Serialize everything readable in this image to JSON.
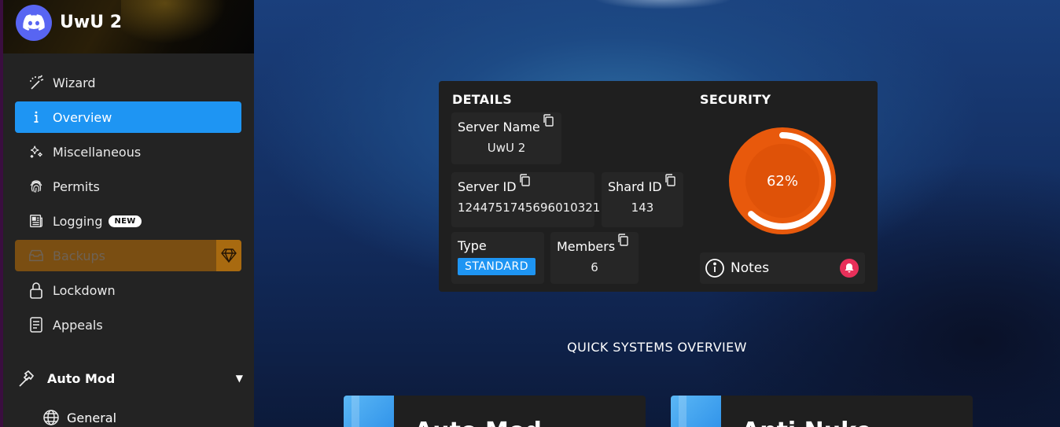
{
  "server": {
    "name": "UwU 2"
  },
  "sidebar": {
    "items": [
      {
        "label": "Wizard"
      },
      {
        "label": "Overview"
      },
      {
        "label": "Miscellaneous"
      },
      {
        "label": "Permits"
      },
      {
        "label": "Logging",
        "badge": "NEW"
      },
      {
        "label": "Backups"
      },
      {
        "label": "Lockdown"
      },
      {
        "label": "Appeals"
      }
    ],
    "group": {
      "label": "Auto Mod",
      "subitems": [
        {
          "label": "General"
        }
      ]
    }
  },
  "details": {
    "heading": "DETAILS",
    "server_name": {
      "label": "Server Name",
      "value": "UwU 2"
    },
    "server_id": {
      "label": "Server ID",
      "value": "1244751745696010321"
    },
    "shard_id": {
      "label": "Shard ID",
      "value": "143"
    },
    "type": {
      "label": "Type",
      "value": "STANDARD"
    },
    "members": {
      "label": "Members",
      "value": "6"
    }
  },
  "security": {
    "heading": "SECURITY",
    "score_label": "62%",
    "score": 0.62,
    "notes_label": "Notes"
  },
  "quick": {
    "title": "QUICK SYSTEMS OVERVIEW",
    "cards": [
      {
        "title": "Auto Mod"
      },
      {
        "title": "Anti Nuke"
      }
    ]
  },
  "colors": {
    "accent": "#1e95f3",
    "premium": "#7a4e12",
    "gauge": "#e8590c",
    "alert": "#e8305a"
  }
}
